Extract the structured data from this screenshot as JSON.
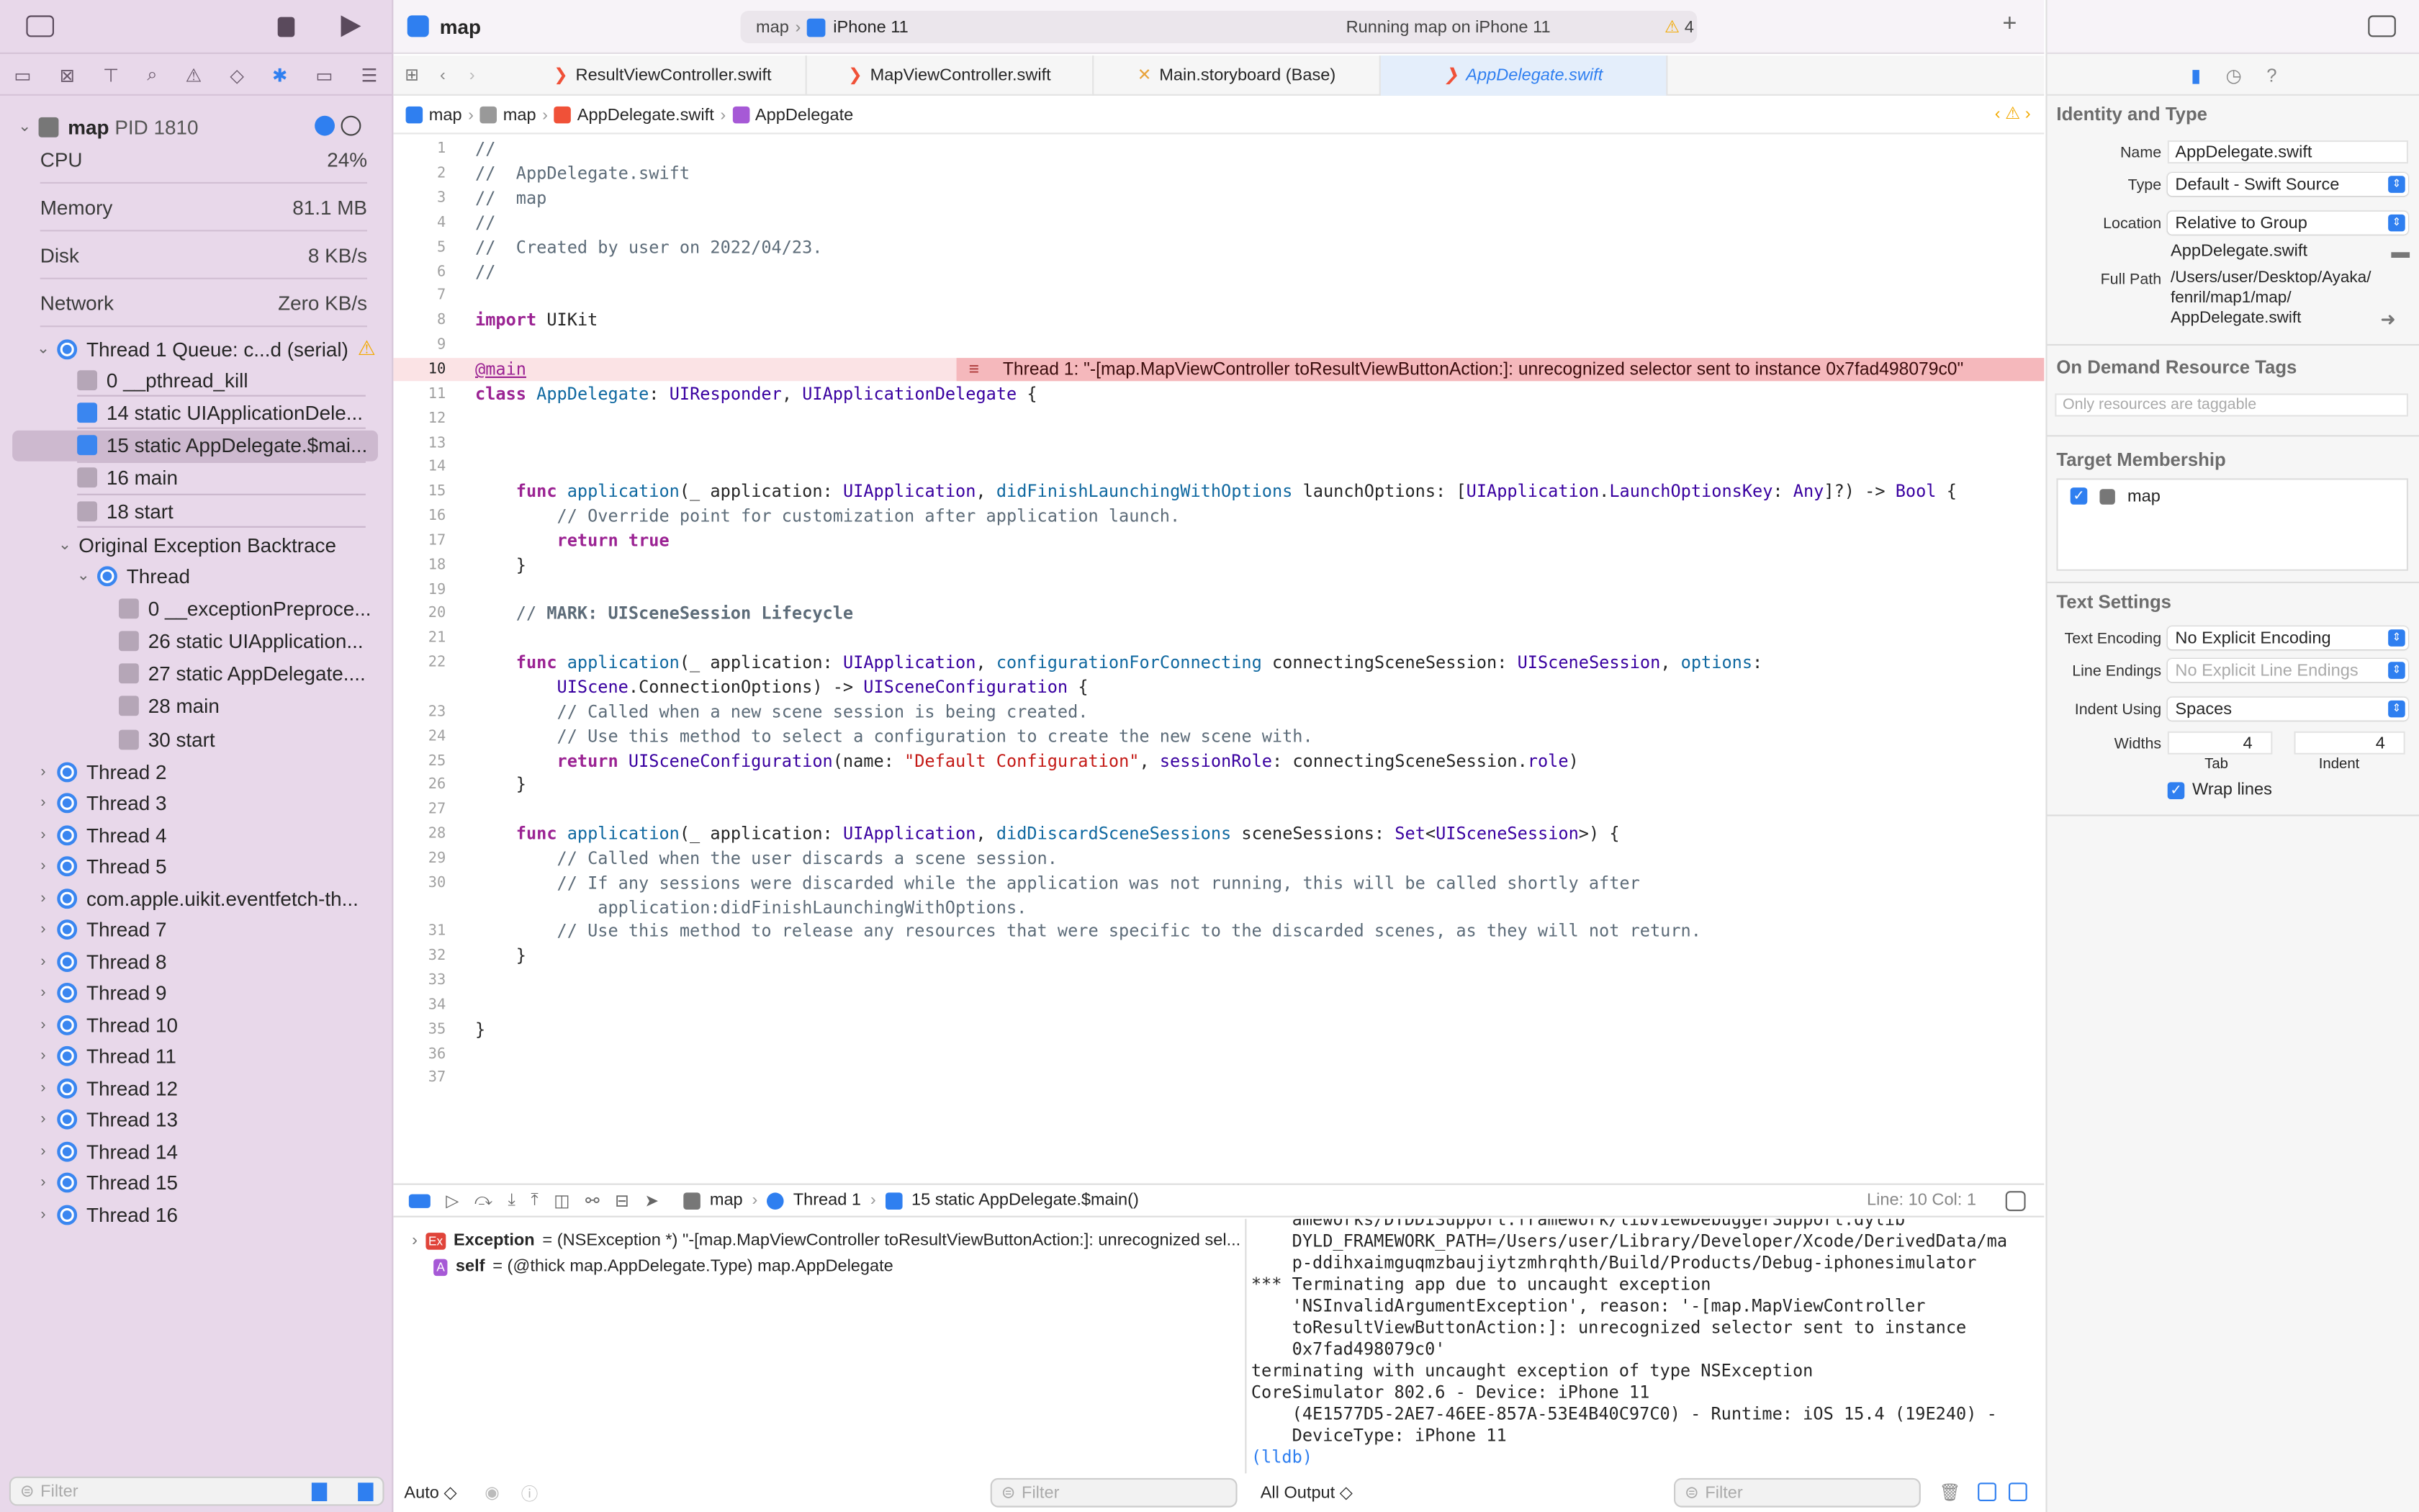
{
  "window": {
    "scheme": "map",
    "destination": "iPhone 11",
    "status": "Running map on iPhone 11",
    "warnings": "4"
  },
  "sidebar": {
    "process": {
      "name": "map",
      "pid": "PID 1810"
    },
    "gauges": [
      {
        "label": "CPU",
        "value": "24%"
      },
      {
        "label": "Memory",
        "value": "81.1 MB"
      },
      {
        "label": "Disk",
        "value": "8 KB/s"
      },
      {
        "label": "Network",
        "value": "Zero KB/s"
      }
    ],
    "thread1": "Thread 1 Queue: c...d (serial)",
    "frames": [
      {
        "label": "0 __pthread_kill",
        "kind": "lib"
      },
      {
        "label": "14 static UIApplicationDele...",
        "kind": "user"
      },
      {
        "label": "15 static AppDelegate.$mai...",
        "kind": "user",
        "selected": true
      },
      {
        "label": "16 main",
        "kind": "lib"
      },
      {
        "label": "18 start",
        "kind": "lib"
      }
    ],
    "backtrace_title": "Original Exception Backtrace",
    "bt_thread": "Thread",
    "bt_frames": [
      "0 __exceptionPreproce...",
      "26 static UIApplication...",
      "27 static AppDelegate....",
      "28 main",
      "30 start"
    ],
    "threads": [
      "Thread 2",
      "Thread 3",
      "Thread 4",
      "Thread 5",
      "com.apple.uikit.eventfetch-th...",
      "Thread 7",
      "Thread 8",
      "Thread 9",
      "Thread 10",
      "Thread 11",
      "Thread 12",
      "Thread 13",
      "Thread 14",
      "Thread 15",
      "Thread 16"
    ],
    "filter_placeholder": "Filter"
  },
  "tabs": [
    {
      "label": "ResultViewController.swift"
    },
    {
      "label": "MapViewController.swift"
    },
    {
      "label": "Main.storyboard (Base)"
    },
    {
      "label": "AppDelegate.swift",
      "active": true
    }
  ],
  "jumpbar": [
    "map",
    "map",
    "AppDelegate.swift",
    "AppDelegate"
  ],
  "error_message": "Thread 1: \"-[map.MapViewController toResultViewButtonAction:]: unrecognized selector sent to instance 0x7fad498079c0\"",
  "code": [
    {
      "n": "1",
      "t": [
        [
          "//",
          "cm"
        ]
      ]
    },
    {
      "n": "2",
      "t": [
        [
          "//  AppDelegate.swift",
          "cm"
        ]
      ]
    },
    {
      "n": "3",
      "t": [
        [
          "//  map",
          "cm"
        ]
      ]
    },
    {
      "n": "4",
      "t": [
        [
          "//",
          "cm"
        ]
      ]
    },
    {
      "n": "5",
      "t": [
        [
          "//  Created by user on 2022/04/23.",
          "cm"
        ]
      ]
    },
    {
      "n": "6",
      "t": [
        [
          "//",
          "cm"
        ]
      ]
    },
    {
      "n": "7",
      "t": []
    },
    {
      "n": "8",
      "t": [
        [
          "import",
          "kw"
        ],
        [
          " UIKit",
          ""
        ]
      ]
    },
    {
      "n": "9",
      "t": []
    },
    {
      "n": "10",
      "t": [
        [
          "@main",
          "at"
        ]
      ],
      "error": true
    },
    {
      "n": "11",
      "t": [
        [
          "class",
          "kw"
        ],
        [
          " ",
          ""
        ],
        [
          "AppDelegate",
          "pt"
        ],
        [
          ": ",
          ""
        ],
        [
          "UIResponder",
          "ty"
        ],
        [
          ", ",
          ""
        ],
        [
          "UIApplicationDelegate",
          "ty"
        ],
        [
          " {",
          ""
        ]
      ]
    },
    {
      "n": "12",
      "t": []
    },
    {
      "n": "13",
      "t": []
    },
    {
      "n": "14",
      "t": []
    },
    {
      "n": "15",
      "t": [
        [
          "    func",
          "kw"
        ],
        [
          " ",
          ""
        ],
        [
          "application",
          "pt"
        ],
        [
          "(_ application: ",
          ""
        ],
        [
          "UIApplication",
          "ty"
        ],
        [
          ", ",
          ""
        ],
        [
          "didFinishLaunchingWithOptions",
          "pt"
        ],
        [
          " launchOptions: [",
          ""
        ],
        [
          "UIApplication",
          "ty"
        ],
        [
          ".",
          ""
        ],
        [
          "LaunchOptionsKey",
          "ty"
        ],
        [
          ": ",
          ""
        ],
        [
          "Any",
          "ty"
        ],
        [
          "]?) -> ",
          ""
        ],
        [
          "Bool",
          "ty"
        ],
        [
          " {",
          ""
        ]
      ]
    },
    {
      "n": "16",
      "t": [
        [
          "        // Override point for customization after application launch.",
          "cm"
        ]
      ]
    },
    {
      "n": "17",
      "t": [
        [
          "        return",
          "kw"
        ],
        [
          " ",
          ""
        ],
        [
          "true",
          "kw"
        ]
      ]
    },
    {
      "n": "18",
      "t": [
        [
          "    }",
          ""
        ]
      ]
    },
    {
      "n": "19",
      "t": []
    },
    {
      "n": "20",
      "t": [
        [
          "    // ",
          "cm"
        ],
        [
          "MARK: UISceneSession Lifecycle",
          "mk"
        ]
      ]
    },
    {
      "n": "21",
      "t": []
    },
    {
      "n": "22",
      "t": [
        [
          "    func",
          "kw"
        ],
        [
          " ",
          ""
        ],
        [
          "application",
          "pt"
        ],
        [
          "(_ application: ",
          ""
        ],
        [
          "UIApplication",
          "ty"
        ],
        [
          ", ",
          ""
        ],
        [
          "configurationForConnecting",
          "pt"
        ],
        [
          " connectingSceneSession: ",
          ""
        ],
        [
          "UISceneSession",
          "ty"
        ],
        [
          ", ",
          ""
        ],
        [
          "options",
          "pt"
        ],
        [
          ":",
          ""
        ]
      ]
    },
    {
      "n": "",
      "t": [
        [
          "        ",
          ""
        ],
        [
          "UIScene",
          "ty"
        ],
        [
          ".ConnectionOptions) -> ",
          ""
        ],
        [
          "UISceneConfiguration",
          "ty"
        ],
        [
          " {",
          ""
        ]
      ]
    },
    {
      "n": "23",
      "t": [
        [
          "        // Called when a new scene session is being created.",
          "cm"
        ]
      ]
    },
    {
      "n": "24",
      "t": [
        [
          "        // Use this method to select a configuration to create the new scene with.",
          "cm"
        ]
      ]
    },
    {
      "n": "25",
      "t": [
        [
          "        return",
          "kw"
        ],
        [
          " ",
          ""
        ],
        [
          "UISceneConfiguration",
          "ty"
        ],
        [
          "(name: ",
          ""
        ],
        [
          "\"Default Configuration\"",
          "st"
        ],
        [
          ", ",
          ""
        ],
        [
          "sessionRole",
          "ty"
        ],
        [
          ": connectingSceneSession.",
          ""
        ],
        [
          "role",
          "ty"
        ],
        [
          ")",
          ""
        ]
      ]
    },
    {
      "n": "26",
      "t": [
        [
          "    }",
          ""
        ]
      ]
    },
    {
      "n": "27",
      "t": []
    },
    {
      "n": "28",
      "t": [
        [
          "    func",
          "kw"
        ],
        [
          " ",
          ""
        ],
        [
          "application",
          "pt"
        ],
        [
          "(_ application: ",
          ""
        ],
        [
          "UIApplication",
          "ty"
        ],
        [
          ", ",
          ""
        ],
        [
          "didDiscardSceneSessions",
          "pt"
        ],
        [
          " sceneSessions: ",
          ""
        ],
        [
          "Set",
          "ty"
        ],
        [
          "<",
          ""
        ],
        [
          "UISceneSession",
          "ty"
        ],
        [
          ">) {",
          ""
        ]
      ]
    },
    {
      "n": "29",
      "t": [
        [
          "        // Called when the user discards a scene session.",
          "cm"
        ]
      ]
    },
    {
      "n": "30",
      "t": [
        [
          "        // If any sessions were discarded while the application was not running, this will be called shortly after",
          "cm"
        ]
      ]
    },
    {
      "n": "",
      "t": [
        [
          "            application:didFinishLaunchingWithOptions.",
          "cm"
        ]
      ]
    },
    {
      "n": "31",
      "t": [
        [
          "        // Use this method to release any resources that were specific to the discarded scenes, as they will not return.",
          "cm"
        ]
      ]
    },
    {
      "n": "32",
      "t": [
        [
          "    }",
          ""
        ]
      ]
    },
    {
      "n": "33",
      "t": []
    },
    {
      "n": "34",
      "t": []
    },
    {
      "n": "35",
      "t": [
        [
          "}",
          ""
        ]
      ]
    },
    {
      "n": "36",
      "t": []
    },
    {
      "n": "37",
      "t": []
    }
  ],
  "debugbar": {
    "path": [
      "map",
      "Thread 1",
      "15 static AppDelegate.$main()"
    ],
    "position": "Line: 10  Col: 1"
  },
  "variables": [
    {
      "badge": "Ex",
      "name": "Exception",
      "value": "= (NSException *) \"-[map.MapViewController toResultViewButtonAction:]: unrecognized sel..."
    },
    {
      "badge": "A",
      "name": "self",
      "value": "= (@thick map.AppDelegate.Type) map.AppDelegate"
    }
  ],
  "console": [
    "    ameworks/DTDDISupport.framework/libViewDebuggerSupport.dylib",
    "    DYLD_FRAMEWORK_PATH=/Users/user/Library/Developer/Xcode/DerivedData/ma",
    "    p-ddihxaimguqmzbaujiytzmhrqhth/Build/Products/Debug-iphonesimulator",
    "*** Terminating app due to uncaught exception",
    "    'NSInvalidArgumentException', reason: '-[map.MapViewController",
    "    toResultViewButtonAction:]: unrecognized selector sent to instance",
    "    0x7fad498079c0'",
    "terminating with uncaught exception of type NSException",
    "CoreSimulator 802.6 - Device: iPhone 11",
    "    (4E1577D5-2AE7-46EE-857A-53E4B40C97C0) - Runtime: iOS 15.4 (19E240) -",
    "    DeviceType: iPhone 11"
  ],
  "console_prompt": "(lldb)",
  "bottom": {
    "auto": "Auto ◇",
    "output": "All Output ◇",
    "filter": "Filter"
  },
  "inspector": {
    "identity_title": "Identity and Type",
    "name_label": "Name",
    "name_value": "AppDelegate.swift",
    "type_label": "Type",
    "type_value": "Default - Swift Source",
    "location_label": "Location",
    "location_value": "Relative to Group",
    "location_file": "AppDelegate.swift",
    "fullpath_label": "Full Path",
    "fullpath_lines": [
      "/Users/user/Desktop/Ayaka/",
      "fenril/map1/map/",
      "AppDelegate.swift"
    ],
    "odr_title": "On Demand Resource Tags",
    "odr_placeholder": "Only resources are taggable",
    "target_title": "Target Membership",
    "target": "map",
    "target_checked": true,
    "text_title": "Text Settings",
    "encoding_label": "Text Encoding",
    "encoding_value": "No Explicit Encoding",
    "endings_label": "Line Endings",
    "endings_value": "No Explicit Line Endings",
    "indent_label": "Indent Using",
    "indent_value": "Spaces",
    "widths_label": "Widths",
    "tab_value": "4",
    "indent_width": "4",
    "tab_caption": "Tab",
    "indent_caption": "Indent",
    "wrap_label": "Wrap lines",
    "wrap_checked": true
  },
  "colors": {
    "sidebar": "#e8d8ea",
    "accent": "#2f7ff0",
    "error_bg": "#f5b8bc",
    "warning": "#f2a900"
  }
}
